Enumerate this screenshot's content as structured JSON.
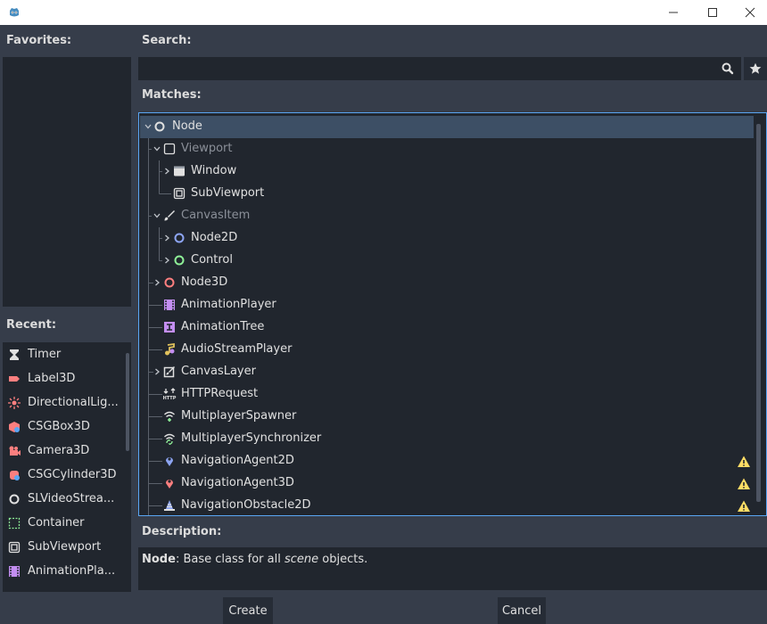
{
  "window": {
    "minimize_icon": "minimize-icon",
    "maximize_icon": "maximize-icon",
    "close_icon": "close-icon"
  },
  "favorites": {
    "label": "Favorites:"
  },
  "recent": {
    "label": "Recent:",
    "items": [
      {
        "label": "Timer",
        "icon": "timer-icon"
      },
      {
        "label": "Label3D",
        "icon": "label3d-icon"
      },
      {
        "label": "DirectionalLig...",
        "icon": "directional-light-icon"
      },
      {
        "label": "CSGBox3D",
        "icon": "csg-box-icon"
      },
      {
        "label": "Camera3D",
        "icon": "camera3d-icon"
      },
      {
        "label": "CSGCylinder3D",
        "icon": "csg-cylinder-icon"
      },
      {
        "label": "SLVideoStrea...",
        "icon": "video-stream-icon"
      },
      {
        "label": "Container",
        "icon": "container-icon"
      },
      {
        "label": "SubViewport",
        "icon": "subviewport-icon"
      },
      {
        "label": "AnimationPla...",
        "icon": "animation-player-icon"
      }
    ]
  },
  "search": {
    "label": "Search:",
    "value": "",
    "placeholder": ""
  },
  "matches": {
    "label": "Matches:",
    "rows": [
      {
        "label": "Node",
        "icon": "node-icon"
      },
      {
        "label": "Viewport",
        "icon": "viewport-icon"
      },
      {
        "label": "Window",
        "icon": "window-icon"
      },
      {
        "label": "SubViewport",
        "icon": "subviewport-icon"
      },
      {
        "label": "CanvasItem",
        "icon": "canvas-item-icon"
      },
      {
        "label": "Node2D",
        "icon": "node2d-icon"
      },
      {
        "label": "Control",
        "icon": "control-icon"
      },
      {
        "label": "Node3D",
        "icon": "node3d-icon"
      },
      {
        "label": "AnimationPlayer",
        "icon": "animation-player-icon"
      },
      {
        "label": "AnimationTree",
        "icon": "animation-tree-icon"
      },
      {
        "label": "AudioStreamPlayer",
        "icon": "audio-stream-player-icon"
      },
      {
        "label": "CanvasLayer",
        "icon": "canvas-layer-icon"
      },
      {
        "label": "HTTPRequest",
        "icon": "http-request-icon"
      },
      {
        "label": "MultiplayerSpawner",
        "icon": "multiplayer-spawner-icon"
      },
      {
        "label": "MultiplayerSynchronizer",
        "icon": "multiplayer-synchronizer-icon"
      },
      {
        "label": "NavigationAgent2D",
        "icon": "navigation-agent-2d-icon"
      },
      {
        "label": "NavigationAgent3D",
        "icon": "navigation-agent-3d-icon"
      },
      {
        "label": "NavigationObstacle2D",
        "icon": "navigation-obstacle-2d-icon"
      }
    ]
  },
  "description": {
    "label": "Description:",
    "name": "Node",
    "text_before": ": Base class for all ",
    "text_em": "scene",
    "text_after": " objects."
  },
  "buttons": {
    "create": "Create",
    "cancel": "Cancel"
  },
  "colors": {
    "background": "#363d4a",
    "panel": "#21262e",
    "selection": "#3d4f65",
    "focus_border": "#5aa6f4",
    "node2d": "#8da5f3",
    "control": "#8eef97",
    "node3d": "#fc7f7f",
    "warning": "#ffdd65"
  }
}
